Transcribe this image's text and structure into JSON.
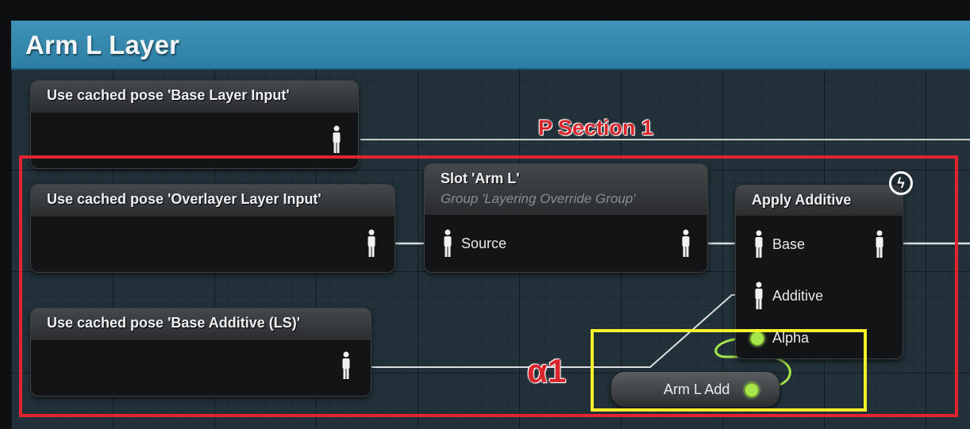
{
  "window": {
    "title": "Arm L Layer"
  },
  "nodes": {
    "cached_base": {
      "title": "Use cached pose 'Base Layer Input'"
    },
    "cached_overlay": {
      "title": "Use cached pose 'Overlayer Layer Input'"
    },
    "cached_additive": {
      "title": "Use cached pose 'Base Additive (LS)'"
    },
    "slot": {
      "title": "Slot 'Arm L'",
      "subtitle": "Group 'Layering Override Group'",
      "source_label": "Source"
    },
    "apply_additive": {
      "title": "Apply Additive",
      "base_label": "Base",
      "additive_label": "Additive",
      "alpha_label": "Alpha"
    },
    "variable": {
      "label": "Arm L Add"
    }
  },
  "annotations": {
    "section_label": "P Section 1",
    "alpha_label": "α1",
    "lightning_glyph": "ϟ"
  },
  "colors": {
    "title_bar": "#3a8db3",
    "red_annotation": "#e02530",
    "yellow_annotation": "#f4f02a",
    "bool_pin": "#a6e64a",
    "wire": "#d9dde0"
  }
}
